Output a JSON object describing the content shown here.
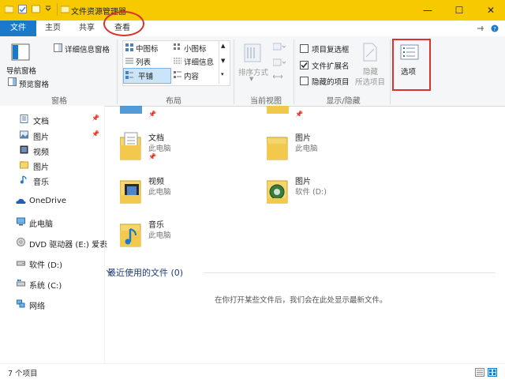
{
  "window": {
    "title": "文件资源管理器",
    "controls": {
      "minimize": "—",
      "maximize": "☐",
      "close": "✕"
    }
  },
  "tabs": {
    "file": "文件",
    "home": "主页",
    "share": "共享",
    "view": "查看"
  },
  "ribbon": {
    "panes": {
      "nav_pane": "导航窗格",
      "preview_pane": "预览窗格",
      "details_pane": "详细信息窗格",
      "group": "窗格"
    },
    "layout": {
      "medium_icons": "中图标",
      "small_icons": "小图标",
      "list": "列表",
      "details": "详细信息",
      "tiles": "平铺",
      "content": "内容",
      "group": "布局"
    },
    "current_view": {
      "sort_by": "排序方式",
      "group": "当前视图"
    },
    "show_hide": {
      "item_checkboxes": "项目复选框",
      "file_extensions": "文件扩展名",
      "hidden_items": "隐藏的项目",
      "hide_selected_1": "隐藏",
      "hide_selected_2": "所选项目",
      "group": "显示/隐藏",
      "item_checkboxes_checked": false,
      "file_extensions_checked": true,
      "hidden_items_checked": false
    },
    "options": {
      "label": "选项"
    }
  },
  "nav": {
    "items": [
      {
        "label": "文档",
        "icon": "documents-icon",
        "pinned": true
      },
      {
        "label": "图片",
        "icon": "pictures-icon",
        "pinned": true
      },
      {
        "label": "视频",
        "icon": "videos-icon",
        "pinned": false
      },
      {
        "label": "图片",
        "icon": "folder-icon",
        "pinned": false
      },
      {
        "label": "音乐",
        "icon": "music-icon",
        "pinned": false
      },
      {
        "label": "OneDrive",
        "icon": "onedrive-icon",
        "pinned": false
      },
      {
        "label": "此电脑",
        "icon": "this-pc-icon",
        "pinned": false
      },
      {
        "label": "DVD 驱动器 (E:) 爱表",
        "icon": "dvd-drive-icon",
        "pinned": false
      },
      {
        "label": "软件 (D:)",
        "icon": "drive-icon",
        "pinned": false
      },
      {
        "label": "系统 (C:)",
        "icon": "system-drive-icon",
        "pinned": false
      },
      {
        "label": "网络",
        "icon": "network-icon",
        "pinned": false
      }
    ]
  },
  "content": {
    "tiles": [
      {
        "name": "文档",
        "sub": "此电脑",
        "pinned": true
      },
      {
        "name": "图片",
        "sub": "此电脑",
        "pinned": false
      },
      {
        "name": "视频",
        "sub": "此电脑",
        "pinned": false
      },
      {
        "name": "图片",
        "sub": "软件 (D:)",
        "pinned": false
      },
      {
        "name": "音乐",
        "sub": "此电脑",
        "pinned": false
      }
    ],
    "recent_header": "最近使用的文件 (0)",
    "empty_message": "在你打开某些文件后，我们会在此处显示最新文件。"
  },
  "status": {
    "item_count": "7 个项目"
  },
  "colors": {
    "titlebar": "#f7c900",
    "file_tab": "#1979ca",
    "highlight": "#d9342b"
  }
}
